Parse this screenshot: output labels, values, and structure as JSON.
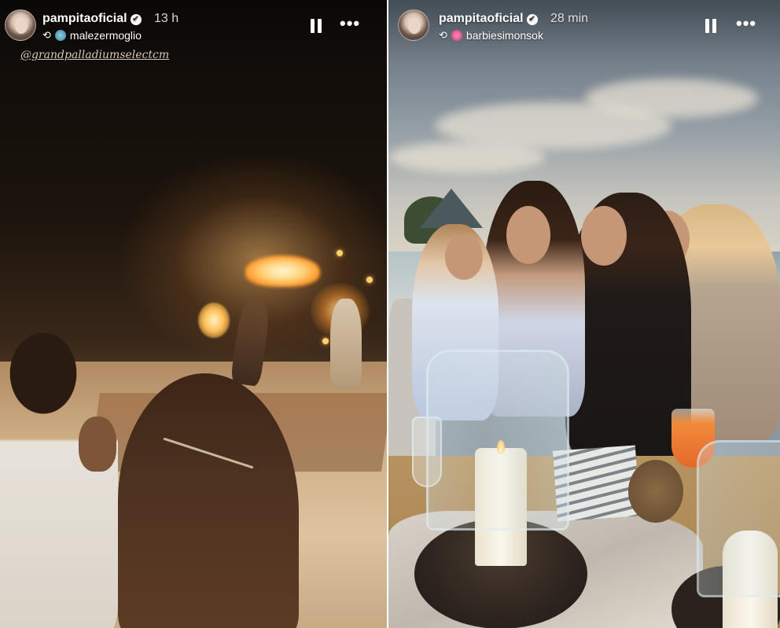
{
  "stories": [
    {
      "username": "pampitaoficial",
      "verified": true,
      "time": "13 h",
      "reposted_from": "malezermoglio",
      "mention": "@grandpalladiumselectcm",
      "controls": {
        "pause_icon": "pause-icon",
        "more_icon": "more-icon"
      }
    },
    {
      "username": "pampitaoficial",
      "verified": true,
      "time": "28 min",
      "reposted_from": "barbiesimonsok",
      "controls": {
        "pause_icon": "pause-icon",
        "more_icon": "more-icon"
      }
    }
  ],
  "glyphs": {
    "verified": "✔",
    "repost": "⟲",
    "more": "•••"
  }
}
